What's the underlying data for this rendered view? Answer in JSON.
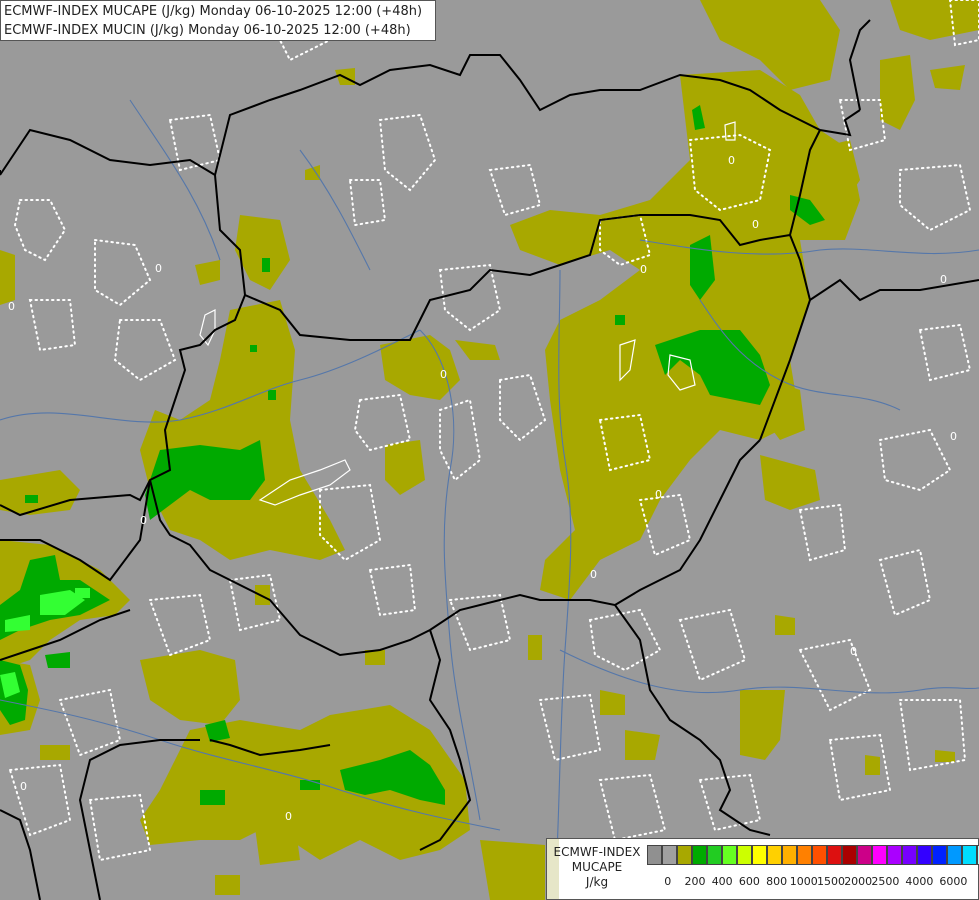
{
  "header": {
    "line1": "ECMWF-INDEX MUCAPE (J/kg) Monday 06-10-2025 12:00 (+48h)",
    "line2": "ECMWF-INDEX MUCIN (J/kg) Monday 06-10-2025 12:00 (+48h)"
  },
  "colors": {
    "background": "#9a9a9a",
    "olive": "#a8a800",
    "green": "#00aa00",
    "bright_green": "#33ff33",
    "border": "#000000",
    "river": "#5577aa"
  },
  "contour_label": "0",
  "legend": {
    "line1": "ECMWF-INDEX",
    "line2": "MUCAPE",
    "line3": "J/kg",
    "swatch_colors": [
      "#909090",
      "#a0a0a0",
      "#a8a800",
      "#00aa00",
      "#22cc22",
      "#66ff22",
      "#ccff00",
      "#ffff00",
      "#ffd000",
      "#ffb000",
      "#ff8000",
      "#ff5000",
      "#dd1010",
      "#aa0000",
      "#cc0088",
      "#ff00ff",
      "#aa00ff",
      "#7700ff",
      "#3300ff",
      "#0022ff",
      "#0099ff",
      "#00ddff",
      "#aaffff",
      "#ffffff"
    ],
    "ticks": [
      "0",
      "200",
      "400",
      "600",
      "800",
      "1000",
      "1500",
      "2000",
      "2500",
      "4000",
      "6000"
    ]
  }
}
